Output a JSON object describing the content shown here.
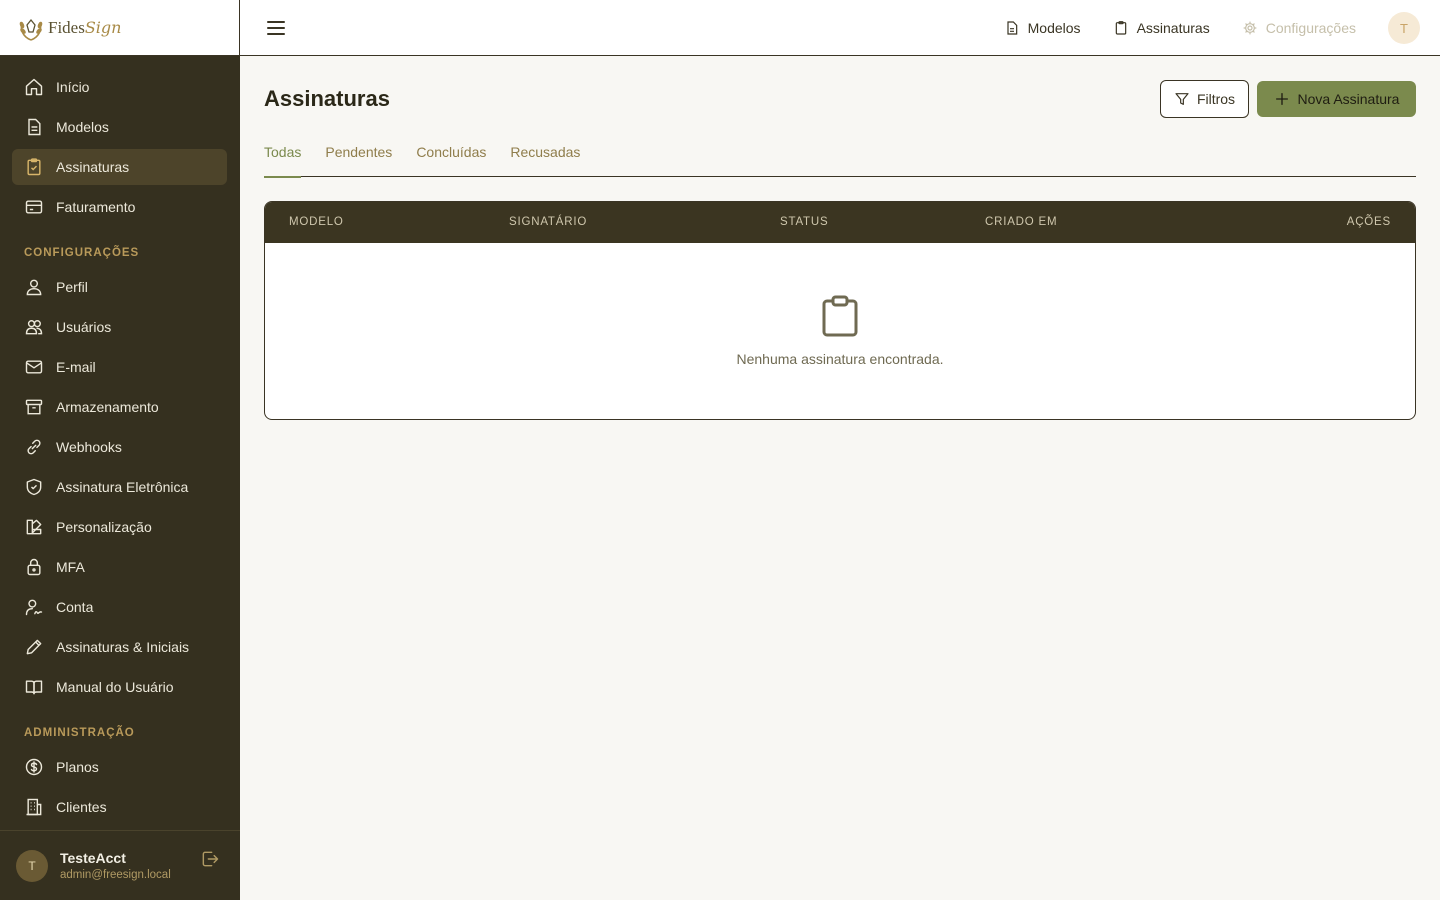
{
  "brand": {
    "name_part1": "Fides",
    "name_part2": "Sign"
  },
  "sidebar": {
    "main_items": [
      {
        "label": "Início",
        "icon": "home-icon"
      },
      {
        "label": "Modelos",
        "icon": "document-icon"
      },
      {
        "label": "Assinaturas",
        "icon": "clipboard-check-icon",
        "active": true
      },
      {
        "label": "Faturamento",
        "icon": "credit-card-icon"
      }
    ],
    "section_config": "CONFIGURAÇÕES",
    "config_items": [
      {
        "label": "Perfil",
        "icon": "user-icon"
      },
      {
        "label": "Usuários",
        "icon": "users-icon"
      },
      {
        "label": "E-mail",
        "icon": "mail-icon"
      },
      {
        "label": "Armazenamento",
        "icon": "archive-icon"
      },
      {
        "label": "Webhooks",
        "icon": "link-icon"
      },
      {
        "label": "Assinatura Eletrônica",
        "icon": "shield-check-icon"
      },
      {
        "label": "Personalização",
        "icon": "palette-icon"
      },
      {
        "label": "MFA",
        "icon": "lock-icon"
      },
      {
        "label": "Conta",
        "icon": "account-sign-icon"
      },
      {
        "label": "Assinaturas & Iniciais",
        "icon": "pen-icon"
      },
      {
        "label": "Manual do Usuário",
        "icon": "book-icon"
      }
    ],
    "section_admin": "ADMINISTRAÇÃO",
    "admin_items": [
      {
        "label": "Planos",
        "icon": "dollar-icon"
      },
      {
        "label": "Clientes",
        "icon": "building-icon"
      }
    ],
    "user": {
      "initial": "T",
      "name": "TesteAcct",
      "email": "admin@freesign.local"
    }
  },
  "topbar": {
    "links": [
      {
        "label": "Modelos",
        "icon": "document-icon"
      },
      {
        "label": "Assinaturas",
        "icon": "clipboard-icon"
      },
      {
        "label": "Configurações",
        "icon": "gear-icon"
      }
    ],
    "avatar_initial": "T"
  },
  "main": {
    "title": "Assinaturas",
    "filter_label": "Filtros",
    "new_label": "Nova Assinatura",
    "tabs": [
      "Todas",
      "Pendentes",
      "Concluídas",
      "Recusadas"
    ],
    "table": {
      "columns": [
        "MODELO",
        "SIGNATÁRIO",
        "STATUS",
        "CRIADO EM",
        "AÇÕES"
      ],
      "empty_message": "Nenhuma assinatura encontrada."
    }
  },
  "colors": {
    "sidebar_bg": "#35301f",
    "accent": "#7b8a4d",
    "gold": "#b99a5a",
    "page_bg": "#f8f7f3"
  }
}
